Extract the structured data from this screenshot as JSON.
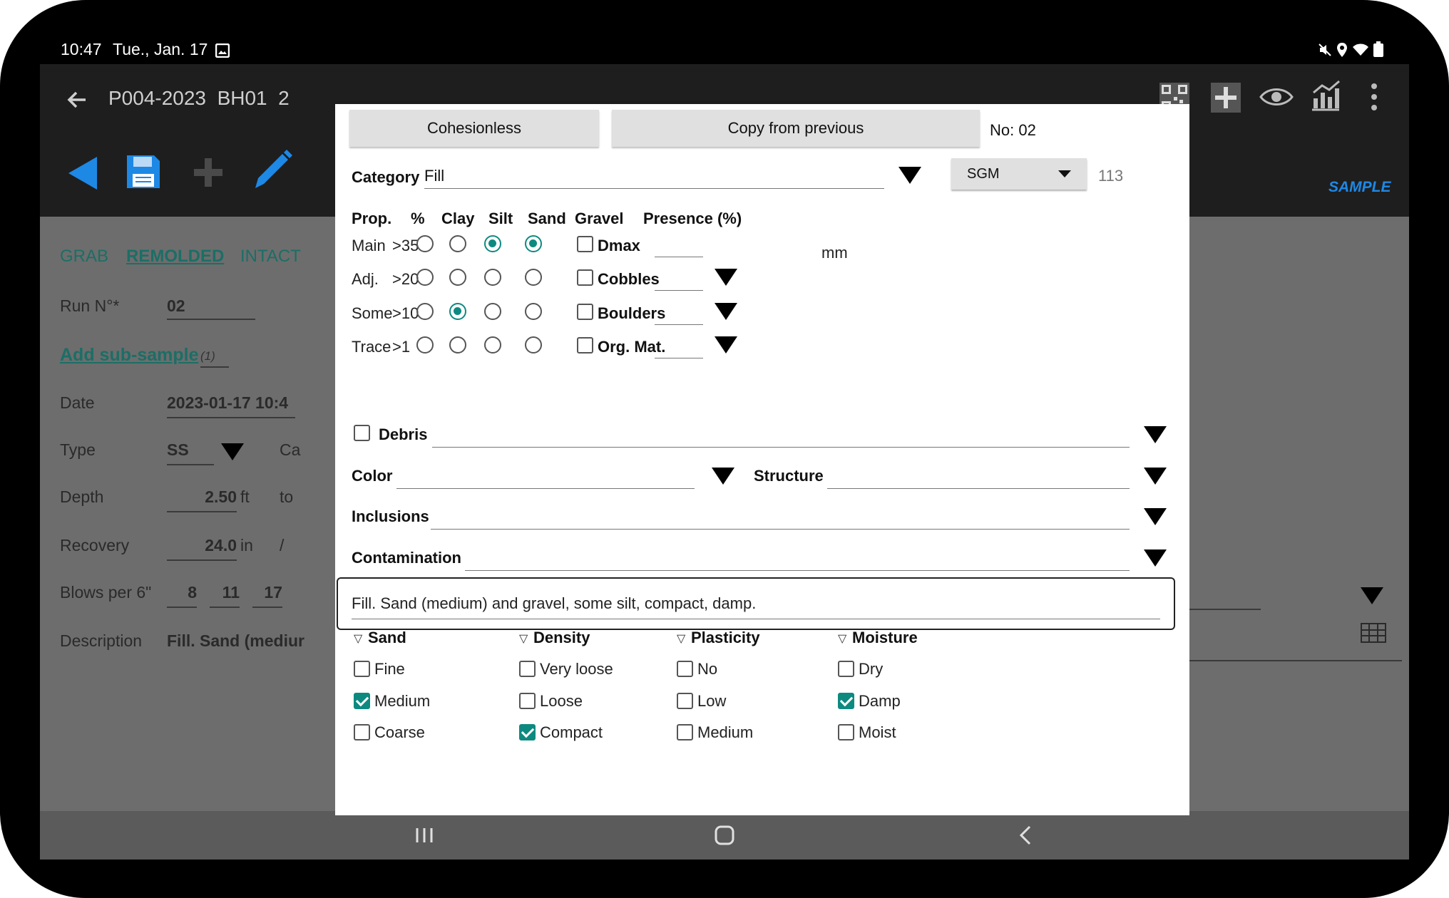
{
  "status": {
    "time": "10:47",
    "date": "Tue., Jan. 17"
  },
  "appbar": {
    "title": "P004-2023  BH01  2",
    "tag": "SAMPLE"
  },
  "tabs": [
    "GRAB",
    "REMOLDED",
    "INTACT"
  ],
  "form": {
    "run_label": "Run N°*",
    "run_value": "02",
    "add_sub": "Add sub-sample",
    "add_sub_count": "(1)",
    "date_label": "Date",
    "date_value": "2023-01-17 10:4",
    "type_label": "Type",
    "type_value": "SS",
    "type_extra": "Ca",
    "depth_label": "Depth",
    "depth_value": "2.50",
    "depth_unit": "ft",
    "depth_to": "to",
    "recovery_label": "Recovery",
    "recovery_value": "24.0",
    "recovery_unit": "in",
    "recovery_sep": "/",
    "blows_label": "Blows per 6\"",
    "blows": [
      "8",
      "11",
      "17"
    ],
    "desc_label": "Description",
    "desc_value": "Fill. Sand (mediur"
  },
  "dialog": {
    "cohesionless_label": "Cohesionless",
    "copy_label": "Copy from previous",
    "no_label": "No: 02",
    "category_label": "Category",
    "category_value": "Fill",
    "sgm_label": "SGM",
    "code_value": "113",
    "prop_headers": [
      "Prop.",
      "%",
      "Clay",
      "Silt",
      "Sand",
      "Gravel"
    ],
    "presence_header": "Presence (%)",
    "prop_rows": [
      {
        "label": "Main",
        "pct": ">35",
        "selected": [
          false,
          false,
          true,
          true
        ]
      },
      {
        "label": "Adj.",
        "pct": ">20",
        "selected": [
          false,
          false,
          false,
          false
        ]
      },
      {
        "label": "Some",
        "pct": ">10",
        "selected": [
          false,
          true,
          false,
          false
        ]
      },
      {
        "label": "Trace",
        "pct": ">1",
        "selected": [
          false,
          false,
          false,
          false
        ]
      }
    ],
    "presence_items": [
      {
        "label": "Dmax",
        "checked": false,
        "unit": "mm"
      },
      {
        "label": "Cobbles",
        "checked": false
      },
      {
        "label": "Boulders",
        "checked": false
      },
      {
        "label": "Org. Mat.",
        "checked": false
      }
    ],
    "debris_label": "Debris",
    "color_label": "Color",
    "structure_label": "Structure",
    "inclusions_label": "Inclusions",
    "contamination_label": "Contamination",
    "description_value": "Fill. Sand (medium) and gravel, some silt, compact, damp.",
    "groups": [
      {
        "title": "Sand",
        "items": [
          {
            "label": "Fine",
            "checked": false
          },
          {
            "label": "Medium",
            "checked": true
          },
          {
            "label": "Coarse",
            "checked": false
          }
        ]
      },
      {
        "title": "Density",
        "items": [
          {
            "label": "Very loose",
            "checked": false
          },
          {
            "label": "Loose",
            "checked": false
          },
          {
            "label": "Compact",
            "checked": true
          }
        ]
      },
      {
        "title": "Plasticity",
        "items": [
          {
            "label": "No",
            "checked": false
          },
          {
            "label": "Low",
            "checked": false
          },
          {
            "label": "Medium",
            "checked": false
          }
        ]
      },
      {
        "title": "Moisture",
        "items": [
          {
            "label": "Dry",
            "checked": false
          },
          {
            "label": "Damp",
            "checked": true
          },
          {
            "label": "Moist",
            "checked": false
          }
        ]
      }
    ]
  },
  "colors": {
    "accent": "#0d8a80",
    "tab_teal": "#1c6e66",
    "toolbar_blue": "#1e88e5"
  }
}
